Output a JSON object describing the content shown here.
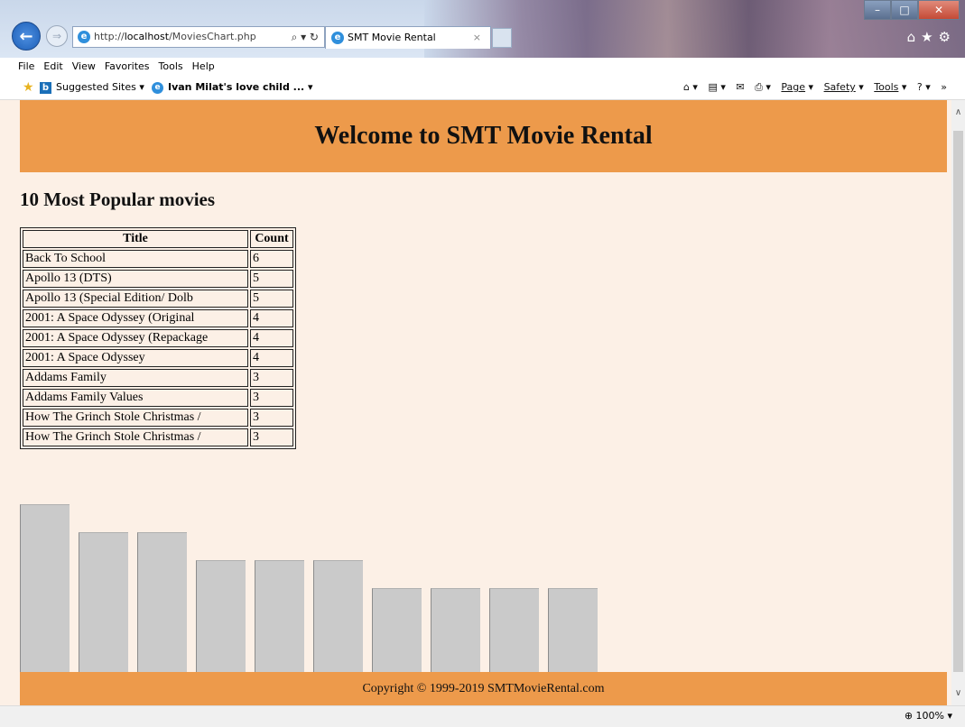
{
  "browser": {
    "address_prefix": "http://",
    "address_host": "localhost",
    "address_path": "/MoviesChart.php",
    "address_tools": "⌕ ▾ ↻",
    "tab_title": "SMT Movie Rental",
    "tab_close": "×",
    "window_buttons": [
      "–",
      "□",
      "✕"
    ],
    "right_icons": "⌂★⚙"
  },
  "menu": [
    "File",
    "Edit",
    "View",
    "Favorites",
    "Tools",
    "Help"
  ],
  "favorites": {
    "suggested": "Suggested Sites ▾",
    "ivan": "Ivan Milat's love child ... ▾"
  },
  "commandbar": {
    "home": "⌂ ▾",
    "feeds": "▤ ▾",
    "mail": "✉",
    "print": "⎙ ▾",
    "page": "Page",
    "safety": "Safety",
    "tools": "Tools",
    "help": "? ▾",
    "chevron": "»"
  },
  "page": {
    "heading": "Welcome to SMT Movie Rental",
    "section_title": "10 Most Popular movies",
    "table_headers": [
      "Title",
      "Count"
    ],
    "movies": [
      {
        "title": "Back To School",
        "count": "6"
      },
      {
        "title": "Apollo 13 (DTS)",
        "count": "5"
      },
      {
        "title": "Apollo 13 (Special Edition/ Dolb",
        "count": "5"
      },
      {
        "title": "2001: A Space Odyssey (Original",
        "count": "4"
      },
      {
        "title": "2001: A Space Odyssey (Repackage",
        "count": "4"
      },
      {
        "title": "2001: A Space Odyssey",
        "count": "4"
      },
      {
        "title": "Addams Family",
        "count": "3"
      },
      {
        "title": "Addams Family Values",
        "count": "3"
      },
      {
        "title": "How The Grinch Stole Christmas /",
        "count": "3"
      },
      {
        "title": "How The Grinch Stole Christmas /",
        "count": "3"
      }
    ],
    "footer": "Copyright © 1999-2019 SMTMovieRental.com"
  },
  "chart_data": {
    "type": "bar",
    "categories": [
      "Back To School",
      "Apollo 13 (DTS)",
      "Apollo 13 (Special Edition/ Dolb",
      "2001: A Space Odyssey (Original",
      "2001: A Space Odyssey (Repackage",
      "2001: A Space Odyssey",
      "Addams Family",
      "Addams Family Values",
      "How The Grinch Stole Christmas /",
      "How The Grinch Stole Christmas /"
    ],
    "values": [
      6,
      5,
      5,
      4,
      4,
      4,
      3,
      3,
      3,
      3
    ],
    "color": "#cacaca"
  },
  "status": {
    "zoom": "⊕ 100% ▾"
  },
  "colors": {
    "band": "#ed9a4b",
    "page_bg": "#fcf0e6"
  }
}
